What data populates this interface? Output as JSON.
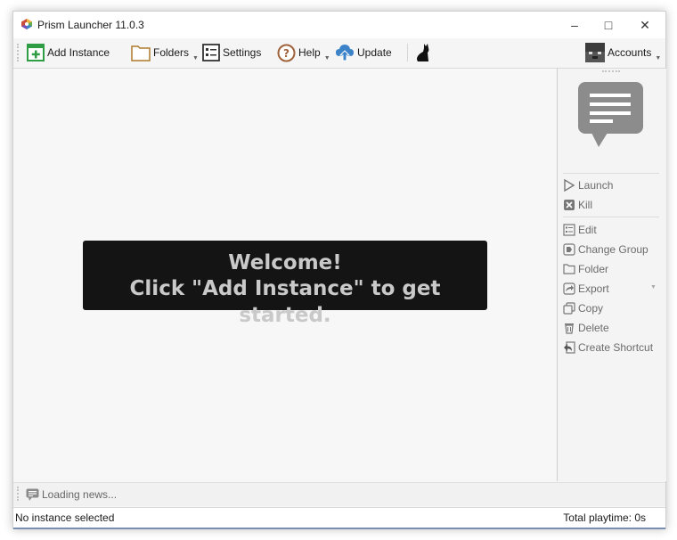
{
  "window": {
    "title": "Prism Launcher 11.0.3",
    "controls": {
      "minimize": "–",
      "maximize": "□",
      "close": "✕"
    }
  },
  "toolbar": {
    "add_instance": "Add Instance",
    "folders": "Folders",
    "settings": "Settings",
    "help": "Help",
    "update": "Update",
    "accounts": "Accounts"
  },
  "welcome": {
    "line1": "Welcome!",
    "line2": "Click \"Add Instance\" to get started."
  },
  "instance_panel": {
    "launch": "Launch",
    "kill": "Kill",
    "edit": "Edit",
    "change_group": "Change Group",
    "folder": "Folder",
    "export": "Export",
    "copy": "Copy",
    "delete": "Delete",
    "create_shortcut": "Create Shortcut"
  },
  "news": {
    "text": "Loading news..."
  },
  "status": {
    "left": "No instance selected",
    "right": "Total playtime: 0s"
  },
  "colors": {
    "add_green": "#2f9d44",
    "help_brown": "#a0623a",
    "update_blue": "#3c82c8",
    "welcome_bg": "#141414",
    "welcome_text": "#c9c9c9"
  },
  "icons": [
    "prism-logo-icon",
    "add-instance-icon",
    "folder-icon",
    "settings-icon",
    "help-icon",
    "update-icon",
    "cat-icon",
    "account-avatar-icon",
    "speech-bubble-icon",
    "launch-icon",
    "kill-icon",
    "edit-icon",
    "change-group-icon",
    "folder-icon",
    "export-icon",
    "copy-icon",
    "delete-icon",
    "create-shortcut-icon",
    "news-icon"
  ]
}
